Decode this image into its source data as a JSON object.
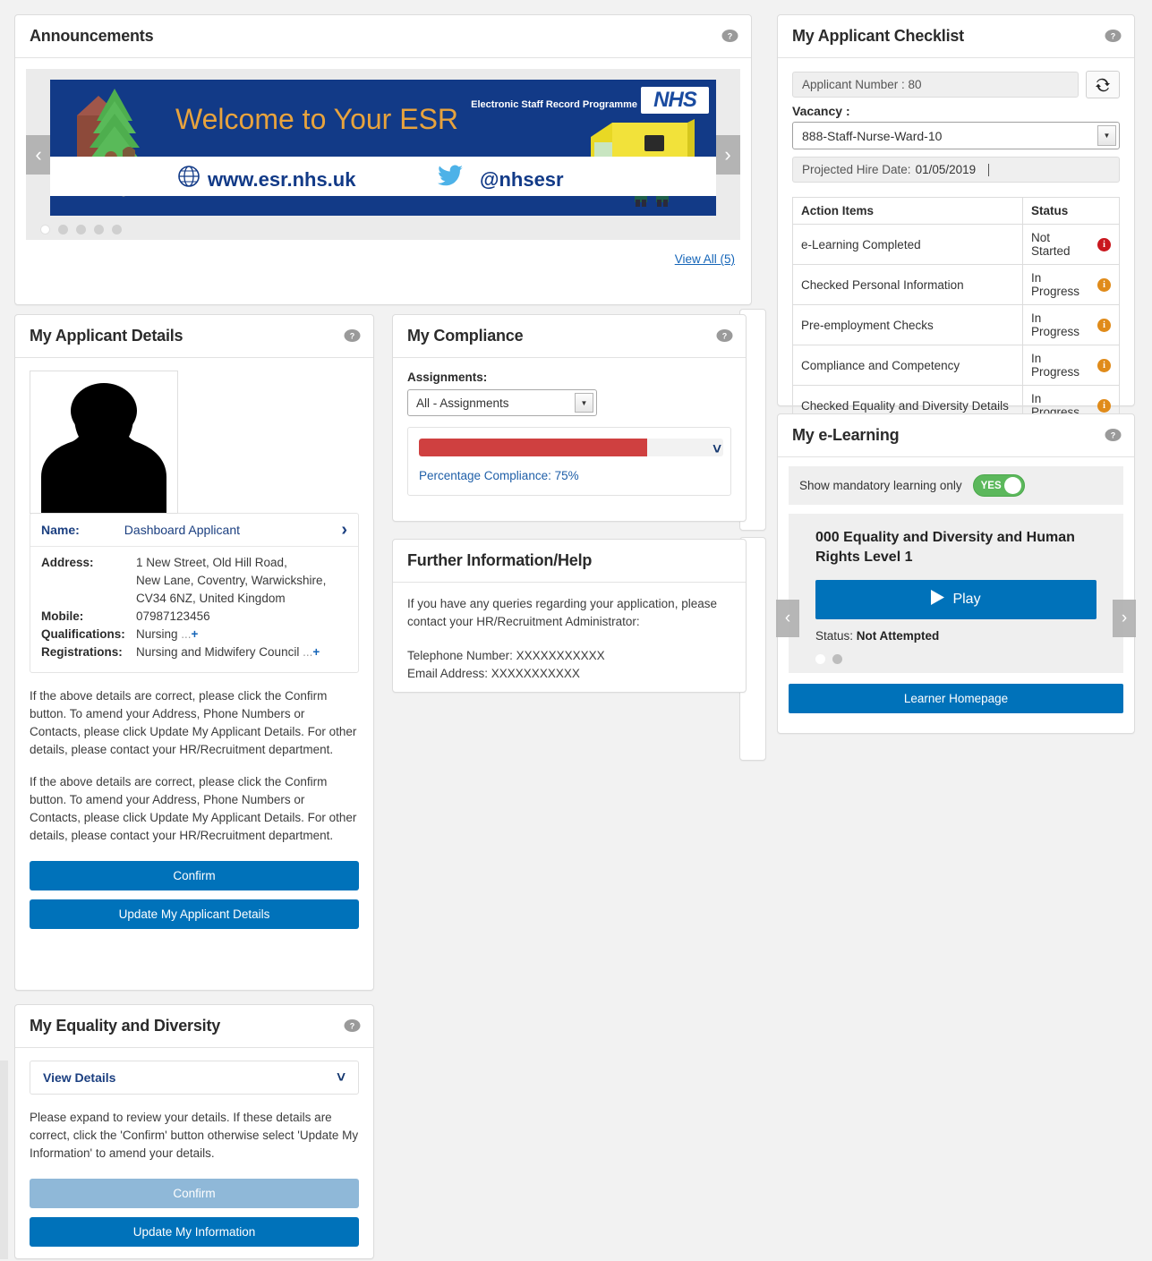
{
  "announcements": {
    "title": "Announcements",
    "help_icon": "help-bubble-icon",
    "prev_label": "‹",
    "next_label": "›",
    "banner": {
      "programme": "Electronic Staff Record Programme",
      "logo": "NHS",
      "welcome": "Welcome to Your ESR",
      "url": "www.esr.nhs.uk",
      "twitter": "@nhsesr"
    },
    "slide_count": 5,
    "active_slide": 1,
    "view_all": "View All (5)"
  },
  "applicant_details": {
    "title": "My Applicant Details",
    "help_icon": "help-bubble-icon",
    "photo_alt": "applicant-silhouette",
    "name_label": "Name:",
    "name_value": "Dashboard Applicant",
    "fields": [
      {
        "label": "Address:",
        "value": "1 New Street, Old Hill Road,"
      },
      {
        "label": "",
        "value": "New Lane, Coventry, Warwickshire,"
      },
      {
        "label": "",
        "value": "CV34 6NZ, United Kingdom"
      },
      {
        "label": "Mobile:",
        "value": "07987123456"
      },
      {
        "label": "Qualifications:",
        "value": "Nursing"
      },
      {
        "label": "Registrations:",
        "value": "Nursing and Midwifery Council"
      }
    ],
    "paragraph_1": "If the above details are correct, please click the Confirm button. To amend your Address, Phone Numbers or Contacts, please click Update My Applicant Details. For other details, please contact your HR/Recruitment department.",
    "paragraph_2": "If the above details are correct, please click the Confirm button. To amend your Address, Phone Numbers or Contacts, please click Update My Applicant Details. For other details, please contact your HR/Recruitment department.",
    "confirm_label": "Confirm",
    "update_label": "Update My Applicant Details"
  },
  "compliance": {
    "title": "My Compliance",
    "help_icon": "help-bubble-icon",
    "assignments_label": "Assignments:",
    "assignments_value": "All - Assignments",
    "percentage_text": "Percentage Compliance: 75%",
    "percentage_value": 75,
    "bar_color": "#cf4040"
  },
  "further_info": {
    "title": "Further Information/Help",
    "intro": "If you have any queries regarding your application, please contact your HR/Recruitment Administrator:",
    "telephone": "Telephone Number: XXXXXXXXXXX",
    "email": "Email Address: XXXXXXXXXXX"
  },
  "equality": {
    "title": "My Equality and Diversity",
    "help_icon": "help-bubble-icon",
    "expander_label": "View Details",
    "paragraph": "Please expand to review your details. If these details are correct, click the 'Confirm' button otherwise select 'Update My Information' to amend your details.",
    "confirm_label": "Confirm",
    "update_label": "Update My Information"
  },
  "checklist": {
    "title": "My Applicant Checklist",
    "help_icon": "help-bubble-icon",
    "applicant_number": "Applicant Number : 80",
    "refresh_icon": "refresh-icon",
    "vacancy_label": "Vacancy :",
    "vacancy_value": "888-Staff-Nurse-Ward-10",
    "hire_date_label": "Projected Hire Date:",
    "hire_date_value": "01/05/2019",
    "columns": [
      "Action Items",
      "Status"
    ],
    "rows": [
      {
        "item": "e-Learning Completed",
        "status": "Not Started",
        "color": "#c9171e"
      },
      {
        "item": "Checked Personal Information",
        "status": "In Progress",
        "color": "#e08b1a"
      },
      {
        "item": "Pre-employment Checks",
        "status": "In Progress",
        "color": "#e08b1a"
      },
      {
        "item": "Compliance and Competency",
        "status": "In Progress",
        "color": "#e08b1a"
      },
      {
        "item": "Checked Equality and Diversity Details",
        "status": "In Progress",
        "color": "#e08b1a"
      }
    ]
  },
  "elearning": {
    "title": "My e-Learning",
    "help_icon": "help-bubble-icon",
    "mandatory_label": "Show mandatory learning only",
    "toggle_value": "YES",
    "course_title": "000 Equality and Diversity and Human Rights Level 1",
    "play_label": "Play",
    "status_label": "Status:",
    "status_value": "Not Attempted",
    "prev_label": "‹",
    "next_label": "›",
    "slide_count": 2,
    "active_slide": 1,
    "learner_homepage_label": "Learner Homepage"
  }
}
